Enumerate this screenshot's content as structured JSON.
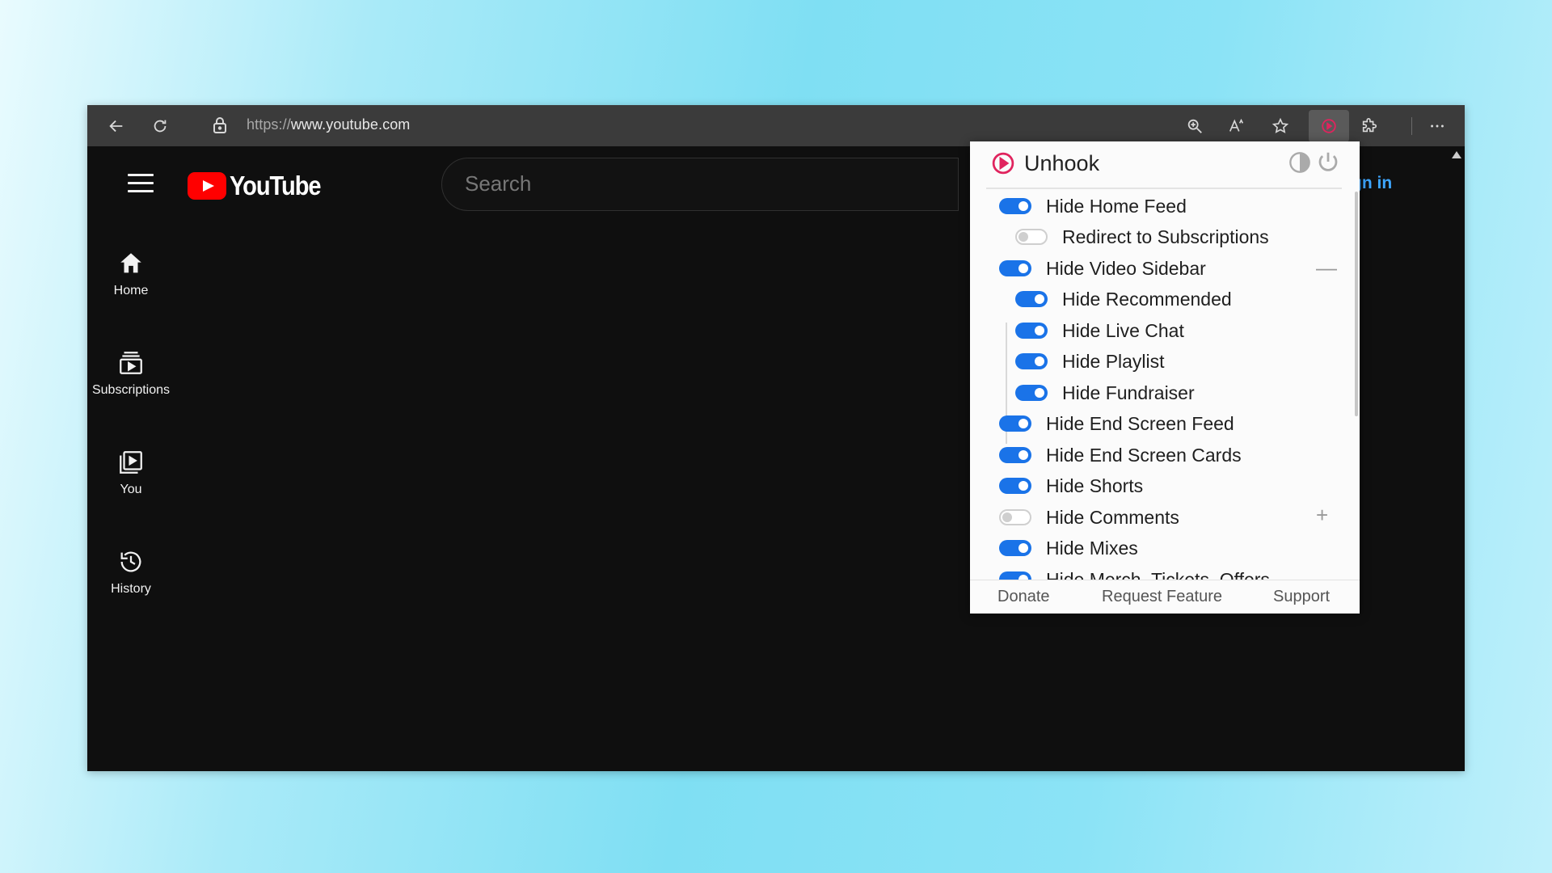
{
  "browser": {
    "url_scheme": "https://",
    "url_host": "www.youtube.com",
    "icons": {
      "back": "back-arrow-icon",
      "refresh": "refresh-icon",
      "lock": "lock-icon",
      "zoom": "zoom-icon",
      "read_aloud": "read-aloud-icon",
      "favorite": "star-icon",
      "unhook": "unhook-extension-icon",
      "extensions": "puzzle-icon",
      "menu": "more-icon"
    }
  },
  "youtube": {
    "logo_text": "YouTube",
    "search_placeholder": "Search",
    "sign_in": "gn in",
    "sidebar": [
      {
        "label": "Home",
        "icon": "home-icon"
      },
      {
        "label": "Subscriptions",
        "icon": "subscriptions-icon"
      },
      {
        "label": "You",
        "icon": "you-icon"
      },
      {
        "label": "History",
        "icon": "history-icon"
      }
    ]
  },
  "unhook": {
    "title": "Unhook",
    "options": [
      {
        "label": "Hide Home Feed",
        "on": true
      },
      {
        "label": "Redirect to Subscriptions",
        "on": false
      },
      {
        "label": "Hide Video Sidebar",
        "on": true
      },
      {
        "label": "Hide Recommended",
        "on": true
      },
      {
        "label": "Hide Live Chat",
        "on": true
      },
      {
        "label": "Hide Playlist",
        "on": true
      },
      {
        "label": "Hide Fundraiser",
        "on": true
      },
      {
        "label": "Hide End Screen Feed",
        "on": true
      },
      {
        "label": "Hide End Screen Cards",
        "on": true
      },
      {
        "label": "Hide Shorts",
        "on": true
      },
      {
        "label": "Hide Comments",
        "on": false
      },
      {
        "label": "Hide Mixes",
        "on": true
      },
      {
        "label": "Hide Merch, Tickets, Offers",
        "on": true
      }
    ],
    "collapse_symbol": "—",
    "expand_symbol": "+",
    "footer": {
      "donate": "Donate",
      "request": "Request Feature",
      "support": "Support"
    }
  },
  "colors": {
    "accent": "#1a73e8",
    "yt_red": "#ff0000",
    "unhook_red": "#e0245e",
    "sign_in_blue": "#3ea6ff"
  }
}
